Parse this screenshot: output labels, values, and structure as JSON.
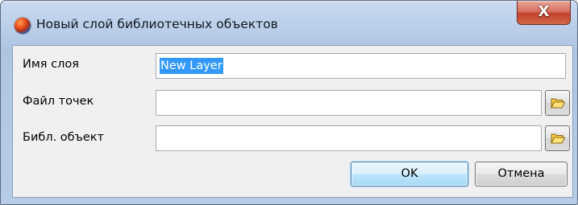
{
  "window": {
    "title": "Новый слой библиотечных объектов",
    "close_glyph": "X"
  },
  "form": {
    "layer_name": {
      "label": "Имя слоя",
      "value": "New Layer"
    },
    "points_file": {
      "label": "Файл точек",
      "value": "",
      "browse_icon": "folder-open-icon"
    },
    "library_object": {
      "label": "Библ. объект",
      "value": "",
      "browse_icon": "folder-open-icon"
    }
  },
  "buttons": {
    "ok_label": "OK",
    "cancel_label": "Отмена"
  },
  "colors": {
    "selection_highlight": "#3399ff",
    "default_button_border": "#3c7fb1",
    "close_button": "#c2412c"
  }
}
